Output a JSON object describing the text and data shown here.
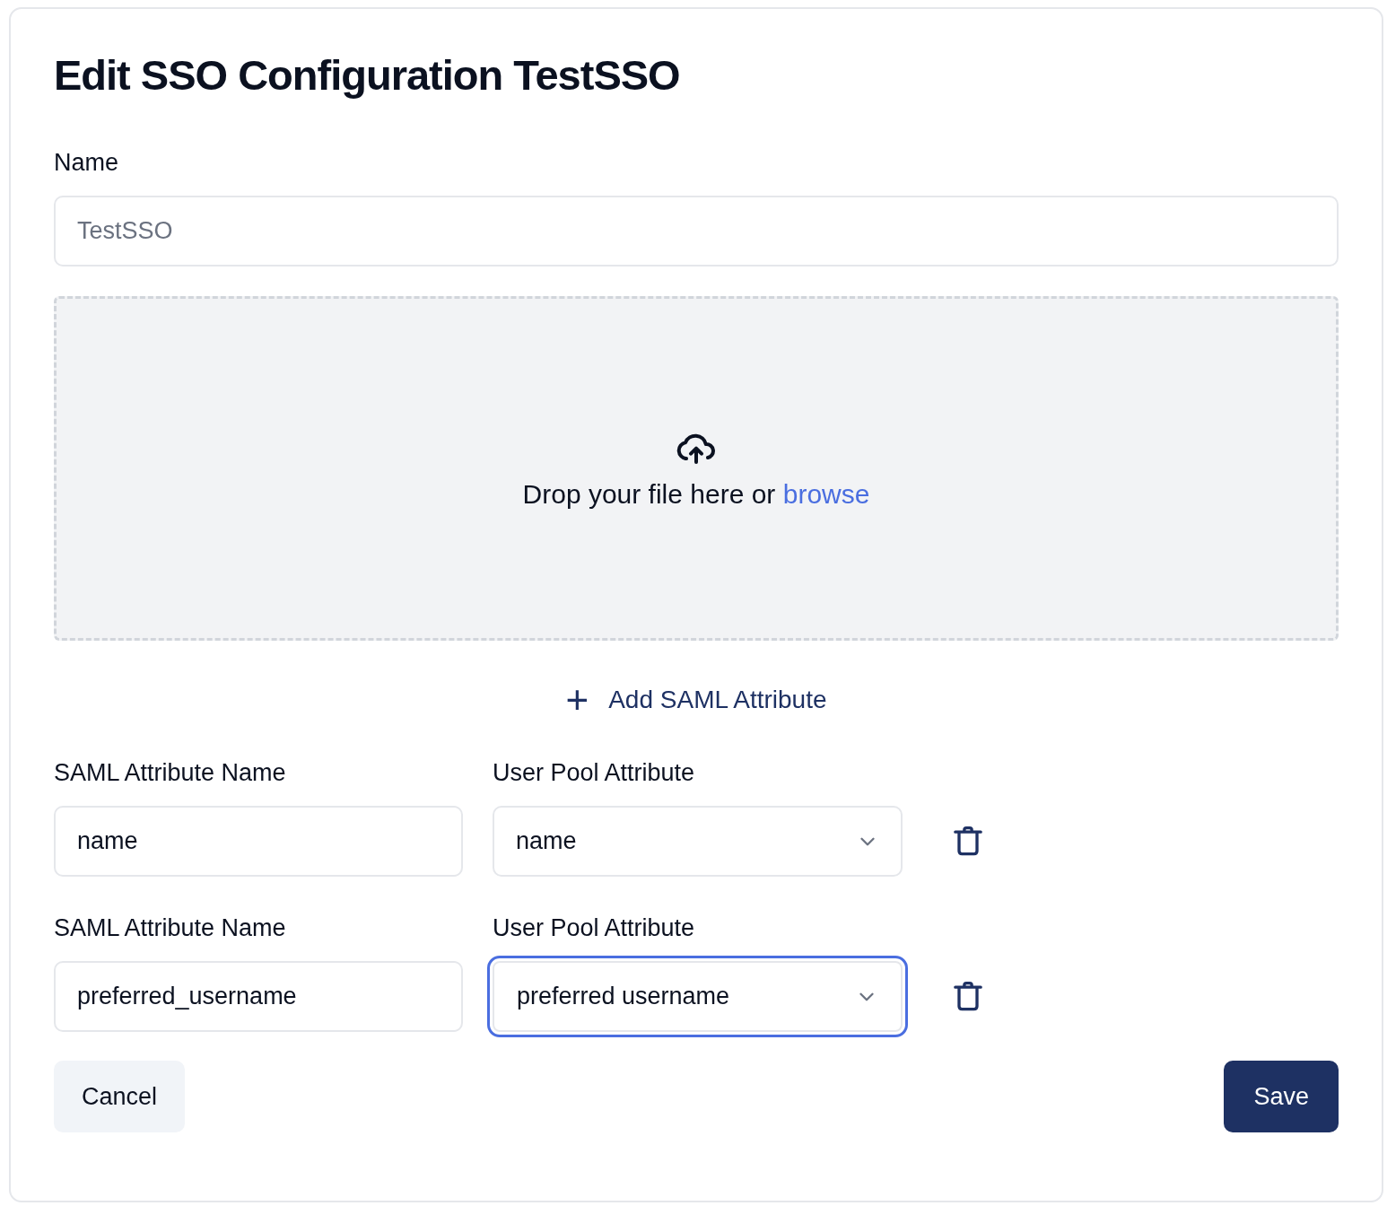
{
  "title": "Edit SSO Configuration TestSSO",
  "name_field": {
    "label": "Name",
    "value": "TestSSO",
    "disabled": true
  },
  "dropzone": {
    "text": "Drop your file here or",
    "link": "browse"
  },
  "add_button": {
    "icon": "+",
    "label": "Add SAML Attribute"
  },
  "attributes": [
    {
      "saml_label": "SAML Attribute Name",
      "saml_value": "name",
      "pool_label": "User Pool Attribute",
      "pool_value": "name",
      "focused": false
    },
    {
      "saml_label": "SAML Attribute Name",
      "saml_value": "preferred_username",
      "pool_label": "User Pool Attribute",
      "pool_value": "preferred username",
      "focused": true
    }
  ],
  "buttons": {
    "cancel": "Cancel",
    "save": "Save"
  }
}
